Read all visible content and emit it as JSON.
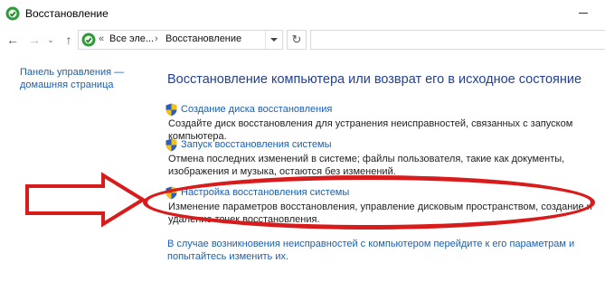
{
  "window": {
    "title": "Восстановление"
  },
  "nav": {
    "breadcrumb_prefix": "«",
    "breadcrumbs": [
      "Все эле...",
      "Восстановление"
    ],
    "separator": "›"
  },
  "sidebar": {
    "home_link": "Панель управления — домашняя страница"
  },
  "main": {
    "heading": "Восстановление компьютера или возврат его в исходное состояние",
    "tasks": [
      {
        "link": "Создание диска восстановления",
        "description": "Создайте диск восстановления для устранения неисправностей, связанных с запуском компьютера."
      },
      {
        "link": "Запуск восстановления системы",
        "description": "Отмена последних изменений в системе; файлы пользователя, такие как документы, изображения и музыка, остаются без изменений."
      },
      {
        "link": "Настройка восстановления системы",
        "description": "Изменение параметров восстановления, управление дисковым пространством, создание и удаление точек восстановления."
      }
    ],
    "footer_link": "В случае возникновения неисправностей с компьютером перейдите к его параметрам и попытайтесь изменить их."
  },
  "colors": {
    "link": "#1a5fb4",
    "heading": "#1f3f9a",
    "annotation": "#d81c1c"
  },
  "icons": {
    "app": "recovery-icon",
    "task": "uac-shield-icon"
  }
}
